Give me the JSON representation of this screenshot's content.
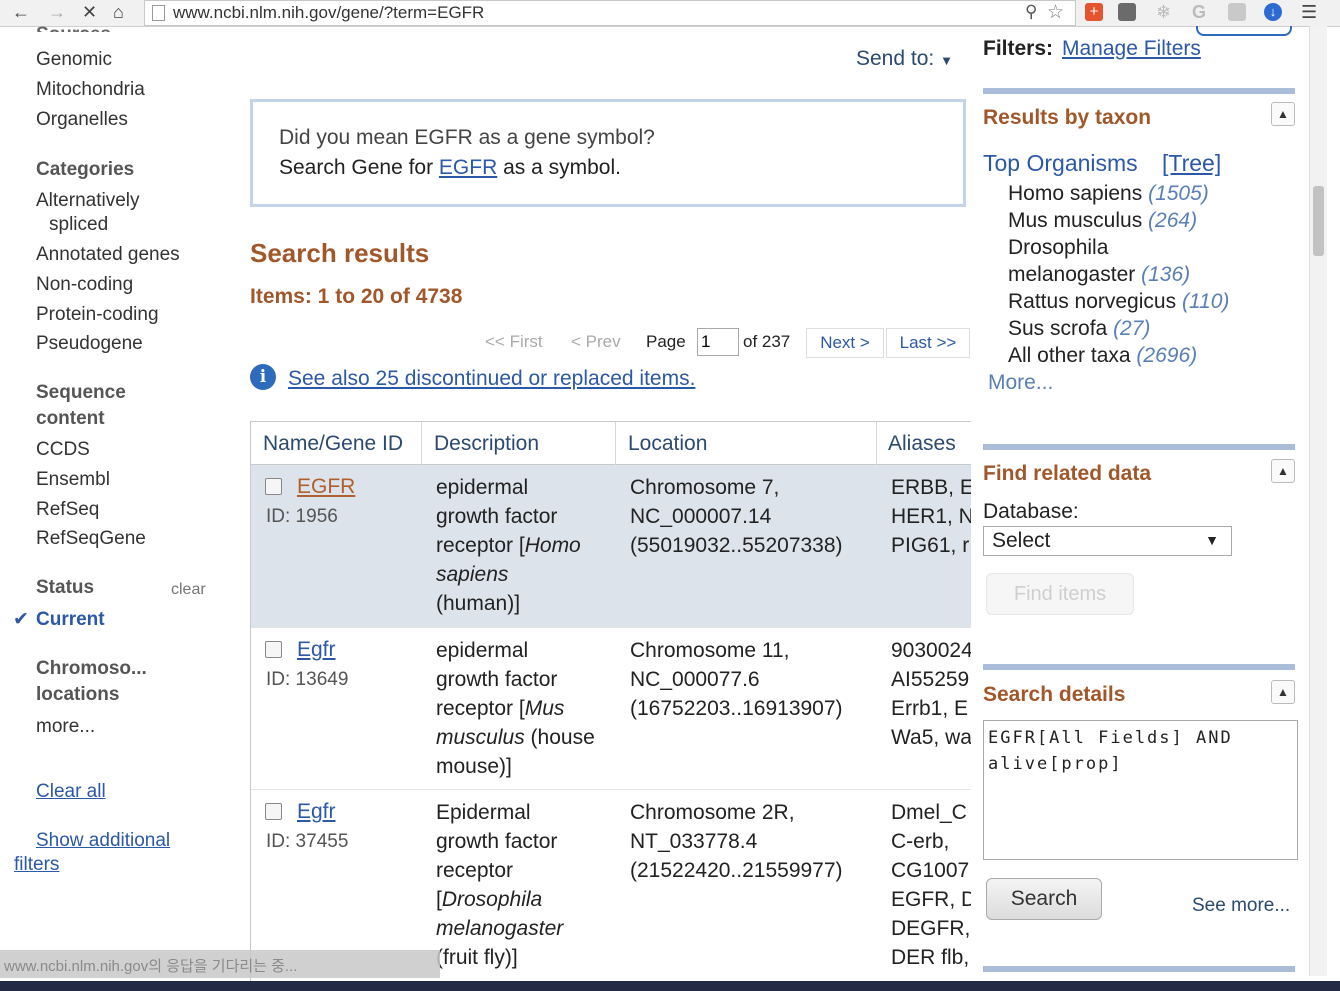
{
  "browser": {
    "url": "www.ncbi.nlm.nih.gov/gene/?term=EGFR",
    "status_text": "www.ncbi.nlm.nih.gov의 응답을 기다리는 중..."
  },
  "sidebar": {
    "sources_partial": "Sources",
    "source_items": [
      "Genomic",
      "Mitochondria",
      "Organelles"
    ],
    "categories_heading": "Categories",
    "categories_items": [
      "Alternatively",
      "spliced",
      "Annotated genes",
      "Non-coding",
      "Protein-coding",
      "Pseudogene"
    ],
    "sequence_heading_1": "Sequence",
    "sequence_heading_2": "content",
    "sequence_items": [
      "CCDS",
      "Ensembl",
      "RefSeq",
      "RefSeqGene"
    ],
    "status_heading": "Status",
    "status_clear": "clear",
    "status_current": "Current",
    "chromo_heading_1": "Chromoso...",
    "chromo_heading_2": "locations",
    "more": "more...",
    "clear_all": "Clear all",
    "show_additional_1": "Show additional",
    "show_additional_2": "filters"
  },
  "main": {
    "send_to": "Send to:",
    "dym_question": "Did you mean EGFR as a gene symbol?",
    "dym_prefix": "Search Gene for ",
    "dym_link": "EGFR",
    "dym_suffix": " as a symbol.",
    "results_heading": "Search results",
    "items_count": "Items: 1 to 20 of 4738",
    "pager": {
      "first": "<< First",
      "prev": "< Prev",
      "page_label": "Page",
      "page_value": "1",
      "of": "of 237",
      "next": "Next >",
      "last": "Last >>"
    },
    "see_also": "See also 25 discontinued or replaced items.",
    "table": {
      "headers": [
        "Name/Gene ID",
        "Description",
        "Location",
        "Aliases"
      ],
      "rows": [
        {
          "name": "EGFR",
          "id": "ID: 1956",
          "desc": [
            "epidermal",
            "growth factor",
            "receptor [Homo",
            "sapiens",
            "(human)]"
          ],
          "loc": [
            "Chromosome 7,",
            "NC_000007.14",
            "(55019032..55207338)"
          ],
          "aliases": [
            "ERBB, E",
            "HER1, N",
            "PIG61, r"
          ]
        },
        {
          "name": "Egfr",
          "id": "ID: 13649",
          "desc": [
            "epidermal",
            "growth factor",
            "receptor [Mus",
            "musculus (house",
            "mouse)]"
          ],
          "loc": [
            "Chromosome 11,",
            "NC_000077.6",
            "(16752203..16913907)"
          ],
          "aliases": [
            "9030024",
            "AI55259",
            "Errb1, E",
            "Wa5, wa"
          ]
        },
        {
          "name": "Egfr",
          "id": "ID: 37455",
          "desc": [
            "Epidermal",
            "growth factor",
            "receptor",
            "[Drosophila",
            "melanogaster",
            "(fruit fly)]"
          ],
          "loc": [
            "Chromosome 2R,",
            "NT_033778.4",
            "(21522420..21559977)"
          ],
          "aliases": [
            "Dmel_C",
            "C-erb,",
            "CG1007",
            "EGFR, D",
            "DEGFR,",
            "DER flb,"
          ]
        }
      ]
    }
  },
  "right": {
    "filters_label": "Filters:",
    "manage_filters": "Manage Filters",
    "taxon_heading": "Results by taxon",
    "top_organisms": "Top Organisms",
    "tree": "[Tree]",
    "taxa": [
      {
        "name": "Homo sapiens",
        "count": "(1505)"
      },
      {
        "name": "Mus musculus",
        "count": "(264)"
      },
      {
        "name": "Drosophila",
        "count": ""
      },
      {
        "name": "melanogaster",
        "count": "(136)"
      },
      {
        "name": "Rattus norvegicus",
        "count": "(110)"
      },
      {
        "name": "Sus scrofa",
        "count": "(27)"
      },
      {
        "name": "All other taxa",
        "count": "(2696)"
      }
    ],
    "taxon_more": "More...",
    "find_heading": "Find related data",
    "database_label": "Database:",
    "database_select": "Select",
    "find_items": "Find items",
    "details_heading": "Search details",
    "details_query": "EGFR[All Fields] AND alive[prop]",
    "search_button": "Search",
    "see_more": "See more..."
  }
}
